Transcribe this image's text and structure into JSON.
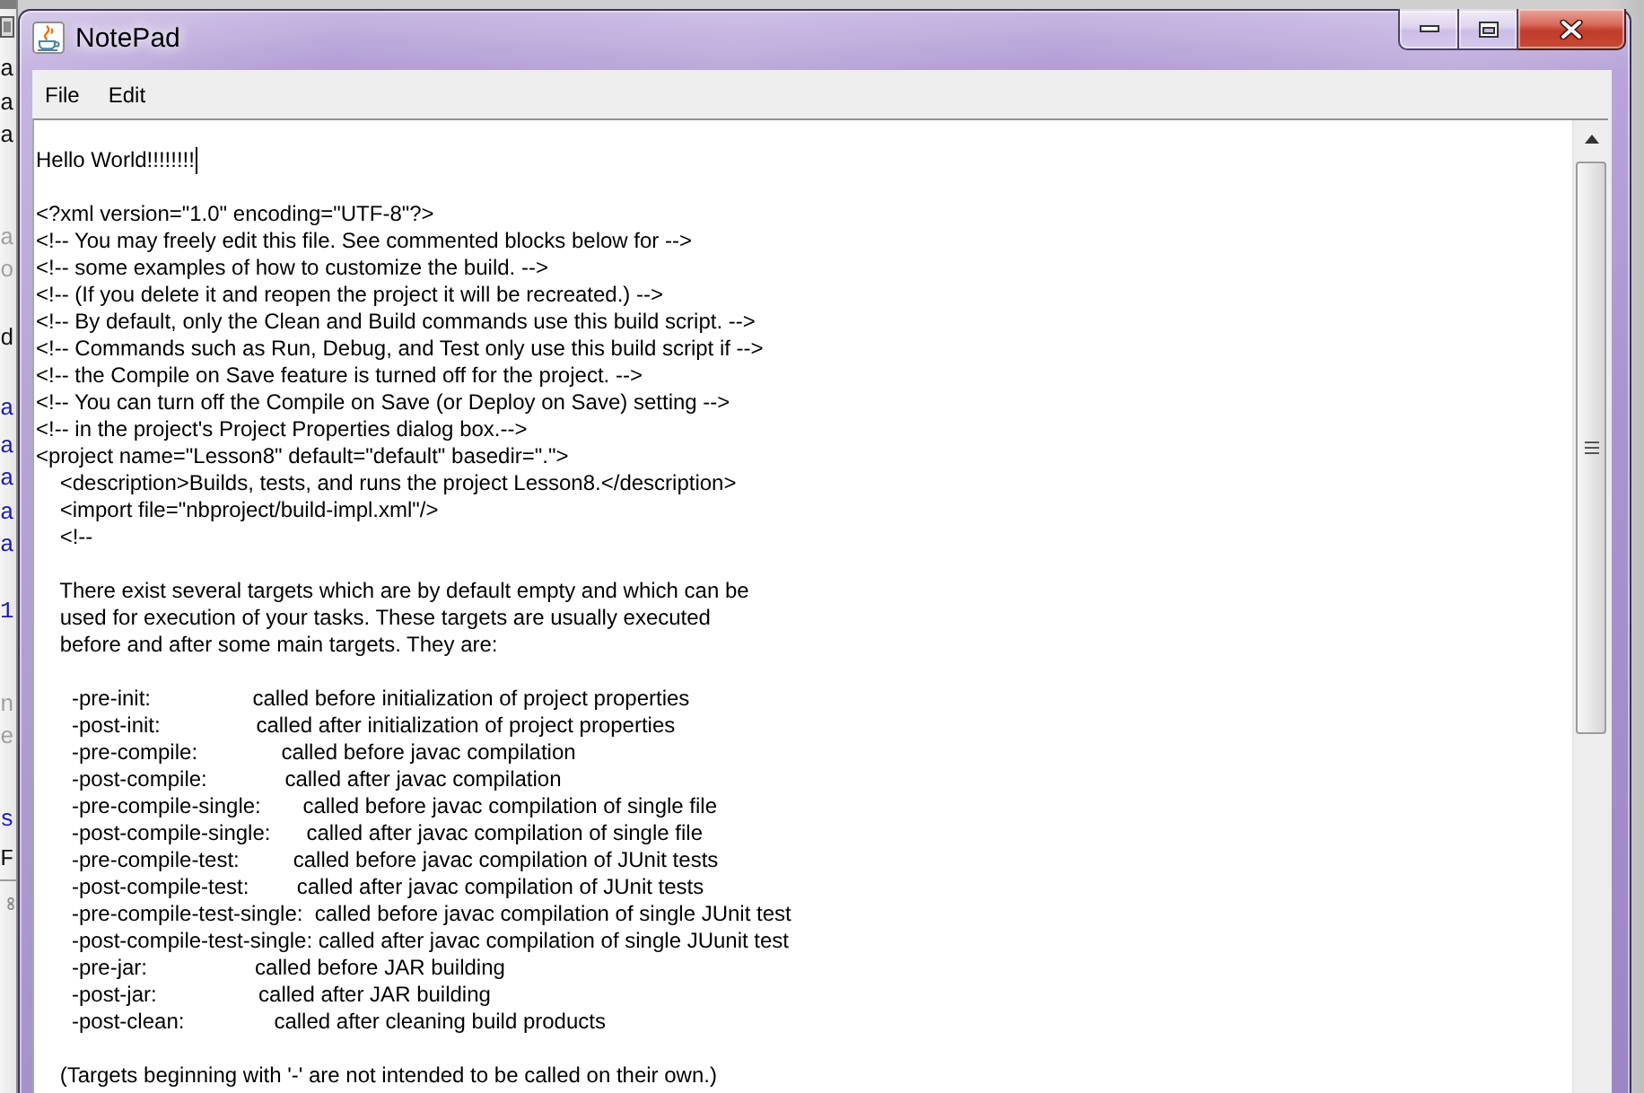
{
  "background_window": {
    "letters": [
      {
        "text": "a",
        "color": "#111111"
      },
      {
        "text": "a",
        "color": "#111111"
      },
      {
        "text": "a",
        "color": "#111111"
      },
      {
        "text": "a",
        "color": "#a0a0a0"
      },
      {
        "text": "o",
        "color": "#a0a0a0"
      },
      {
        "text": "d",
        "color": "#111111"
      },
      {
        "text": "a",
        "color": "#1c1ca6"
      },
      {
        "text": "a",
        "color": "#1c1ca6"
      },
      {
        "text": "a",
        "color": "#1c1ca6"
      },
      {
        "text": "a",
        "color": "#1c1ca6"
      },
      {
        "text": "a",
        "color": "#1c1ca6"
      },
      {
        "text": "1",
        "color": "#1c1ca6"
      },
      {
        "text": "n",
        "color": "#a0a0a0"
      },
      {
        "text": "e",
        "color": "#a0a0a0"
      },
      {
        "text": "s",
        "color": "#1c1ca6"
      },
      {
        "text": "F",
        "color": "#111111"
      }
    ]
  },
  "window": {
    "title": "NotePad"
  },
  "menu_bar": [
    "File",
    "Edit"
  ],
  "editor": {
    "paragraphs": [
      {
        "lines": [
          {
            "text": "Hello World!!!!!!!!",
            "caret": true
          }
        ]
      },
      {
        "lines": [
          {
            "text": "<?xml version=\"1.0\" encoding=\"UTF-8\"?>",
            "caret": false
          },
          {
            "text": "<!-- You may freely edit this file. See commented blocks below for -->",
            "caret": false
          },
          {
            "text": "<!-- some examples of how to customize the build. -->",
            "caret": false
          },
          {
            "text": "<!-- (If you delete it and reopen the project it will be recreated.) -->",
            "caret": false
          },
          {
            "text": "<!-- By default, only the Clean and Build commands use this build script. -->",
            "caret": false
          },
          {
            "text": "<!-- Commands such as Run, Debug, and Test only use this build script if -->",
            "caret": false
          },
          {
            "text": "<!-- the Compile on Save feature is turned off for the project. -->",
            "caret": false
          },
          {
            "text": "<!-- You can turn off the Compile on Save (or Deploy on Save) setting -->",
            "caret": false
          },
          {
            "text": "<!-- in the project's Project Properties dialog box.-->",
            "caret": false
          },
          {
            "text": "<project name=\"Lesson8\" default=\"default\" basedir=\".\">",
            "caret": false
          },
          {
            "text": "    <description>Builds, tests, and runs the project Lesson8.</description>",
            "caret": false
          },
          {
            "text": "    <import file=\"nbproject/build-impl.xml\"/>",
            "caret": false
          },
          {
            "text": "    <!--",
            "caret": false
          }
        ]
      },
      {
        "lines": [
          {
            "text": "    There exist several targets which are by default empty and which can be",
            "caret": false
          },
          {
            "text": "    used for execution of your tasks. These targets are usually executed",
            "caret": false
          },
          {
            "text": "    before and after some main targets. They are:",
            "caret": false
          }
        ]
      },
      {
        "lines": [
          {
            "text": "      -pre-init:                 called before initialization of project properties",
            "caret": false
          },
          {
            "text": "      -post-init:                called after initialization of project properties",
            "caret": false
          },
          {
            "text": "      -pre-compile:              called before javac compilation",
            "caret": false
          },
          {
            "text": "      -post-compile:             called after javac compilation",
            "caret": false
          },
          {
            "text": "      -pre-compile-single:       called before javac compilation of single file",
            "caret": false
          },
          {
            "text": "      -post-compile-single:      called after javac compilation of single file",
            "caret": false
          },
          {
            "text": "      -pre-compile-test:         called before javac compilation of JUnit tests",
            "caret": false
          },
          {
            "text": "      -post-compile-test:        called after javac compilation of JUnit tests",
            "caret": false
          },
          {
            "text": "      -pre-compile-test-single:  called before javac compilation of single JUnit test",
            "caret": false
          },
          {
            "text": "      -post-compile-test-single: called after javac compilation of single JUunit test",
            "caret": false
          },
          {
            "text": "      -pre-jar:                  called before JAR building",
            "caret": false
          },
          {
            "text": "      -post-jar:                 called after JAR building",
            "caret": false
          },
          {
            "text": "      -post-clean:               called after cleaning build products",
            "caret": false
          }
        ]
      },
      {
        "lines": [
          {
            "text": "    (Targets beginning with '-' are not intended to be called on their own.)",
            "caret": false
          }
        ]
      }
    ]
  }
}
